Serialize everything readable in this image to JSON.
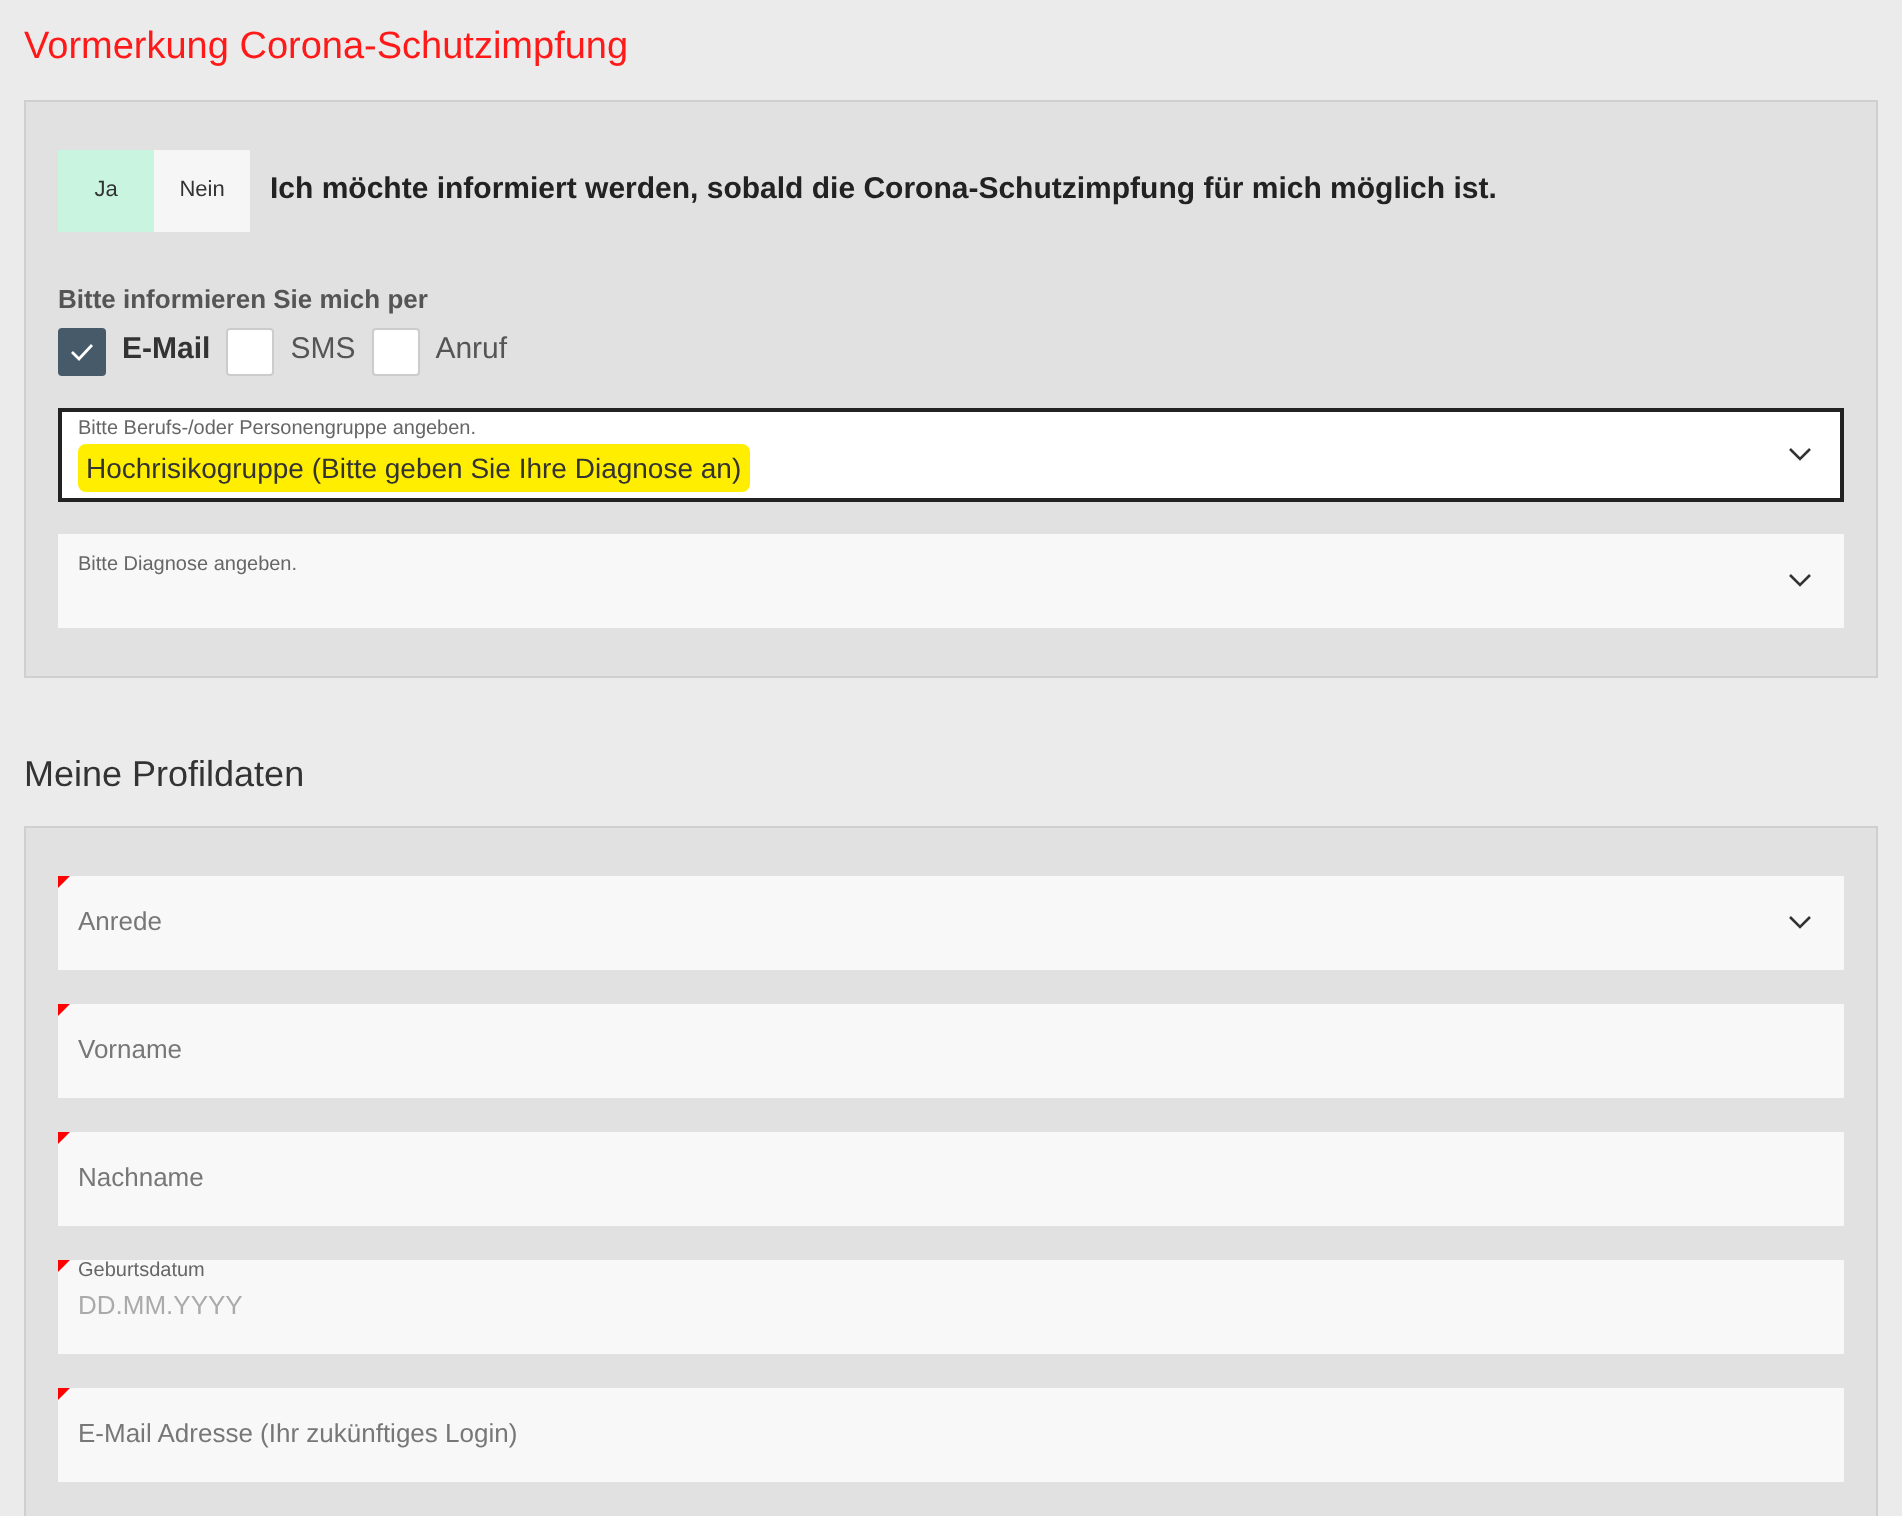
{
  "page_title": "Vormerkung Corona-Schutzimpfung",
  "vaccination": {
    "toggle": [
      {
        "label": "Ja",
        "selected": true
      },
      {
        "label": "Nein",
        "selected": false
      }
    ],
    "question": "Ich möchte informiert werden, sobald die Corona-Schutzimpfung für mich möglich ist.",
    "contact_label": "Bitte informieren Sie mich per",
    "channels": [
      {
        "label": "E-Mail",
        "checked": true
      },
      {
        "label": "SMS",
        "checked": false
      },
      {
        "label": "Anruf",
        "checked": false
      }
    ],
    "fields": [
      {
        "kind": "select",
        "label": "Bitte Berufs-/oder Personengruppe angeben.",
        "value": "Hochrisikogruppe (Bitte geben Sie Ihre Diagnose an)",
        "focused": true,
        "highlighted": true,
        "required": false
      },
      {
        "kind": "select",
        "label": "Bitte Diagnose angeben.",
        "focused": false
      }
    ]
  },
  "profile": {
    "heading": "Meine Profildaten",
    "fields": [
      {
        "kind": "select",
        "placeholder": "Anrede",
        "required": true,
        "focused": false
      },
      {
        "kind": "text",
        "placeholder": "Vorname",
        "required": true,
        "focused": false
      },
      {
        "kind": "text",
        "placeholder": "Nachname",
        "required": true,
        "focused": false
      },
      {
        "kind": "date",
        "label": "Geburtsdatum",
        "placeholder": "DD.MM.YYYY",
        "required": true,
        "focused": false
      },
      {
        "kind": "text",
        "placeholder": "E-Mail Adresse (Ihr zukünftiges Login)",
        "required": true,
        "focused": false
      }
    ]
  }
}
